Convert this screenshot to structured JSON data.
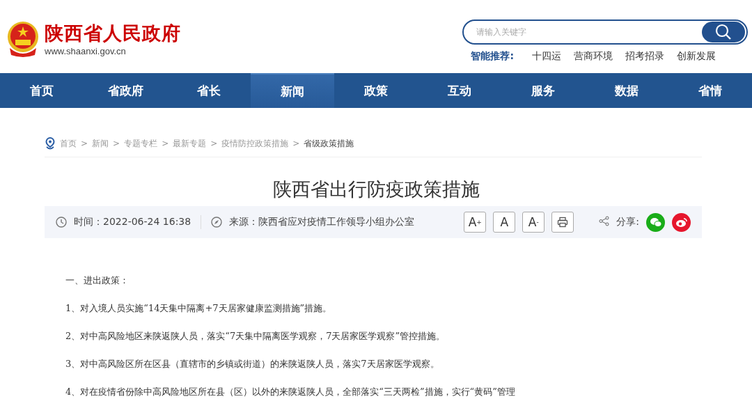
{
  "site": {
    "name": "陕西省人民政府",
    "url": "www.shaanxi.gov.cn"
  },
  "search": {
    "placeholder": "请输入关键字"
  },
  "recommend": {
    "label": "智能推荐:",
    "items": [
      "十四运",
      "营商环境",
      "招考招录",
      "创新发展"
    ]
  },
  "nav": [
    {
      "label": "首页",
      "selected": false
    },
    {
      "label": "省政府",
      "selected": false
    },
    {
      "label": "省长",
      "selected": false
    },
    {
      "label": "新闻",
      "selected": true
    },
    {
      "label": "政策",
      "selected": false
    },
    {
      "label": "互动",
      "selected": false
    },
    {
      "label": "服务",
      "selected": false
    },
    {
      "label": "数据",
      "selected": false
    },
    {
      "label": "省情",
      "selected": false
    }
  ],
  "breadcrumb": [
    "首页",
    "新闻",
    "专题专栏",
    "最新专题",
    "疫情防控政策措施",
    "省级政策措施"
  ],
  "breadcrumb_separator": ">",
  "article": {
    "title": "陕西省出行防疫政策措施",
    "time": "时间：2022-06-24 16:38",
    "source": "来源：陕西省应对疫情工作领导小组办公室",
    "font_buttons": [
      {
        "label": "A",
        "sup": "+"
      },
      {
        "label": "A"
      },
      {
        "label": "A",
        "sup": "-"
      }
    ],
    "share_label": "分享:",
    "paragraphs": [
      "一、进出政策：",
      "1、对入境人员实施“14天集中隔离+7天居家健康监测措施”措施。",
      "2、对中高风险地区来陕返陕人员，落实“7天集中隔离医学观察，7天居家医学观察”管控措施。",
      "3、对中高风险区所在区县（直辖市的乡镇或街道）的来陕返陕人员，落实7天居家医学观察。",
      "4、对在疫情省份除中高风险地区所在县（区）以外的来陕返陕人员，全部落实“三天两检”措施，实行“黄码”管理"
    ]
  }
}
